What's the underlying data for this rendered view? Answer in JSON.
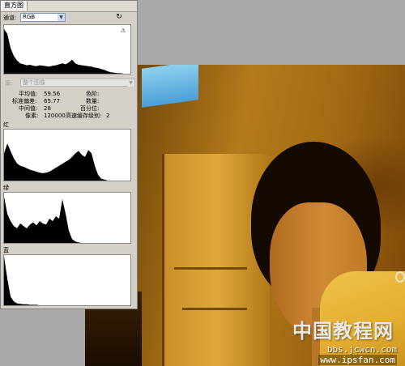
{
  "panel": {
    "tab_title": "直方图",
    "channel_label": "通道:",
    "channel_value": "RGB",
    "source_label": "源:",
    "source_value": "整个图像",
    "warning_glyph": "⚠"
  },
  "stats": {
    "mean_label": "平均值:",
    "mean_value": "59.56",
    "stddev_label": "标准偏差:",
    "stddev_value": "65.77",
    "median_label": "中间值:",
    "median_value": "28",
    "pixels_label": "像素:",
    "pixels_value": "120000",
    "level_label": "色阶:",
    "level_value": "",
    "count_label": "数量:",
    "count_value": "",
    "percentile_label": "百分位:",
    "percentile_value": "",
    "cache_label": "高速缓存级别:",
    "cache_value": "2"
  },
  "channels": {
    "red_label": "红",
    "green_label": "绿",
    "blue_label": "蓝"
  },
  "histograms": {
    "rgb": [
      0.95,
      0.85,
      0.55,
      0.38,
      0.28,
      0.22,
      0.2,
      0.18,
      0.19,
      0.17,
      0.16,
      0.18,
      0.17,
      0.16,
      0.15,
      0.17,
      0.18,
      0.2,
      0.22,
      0.2,
      0.24,
      0.3,
      0.22,
      0.19,
      0.18,
      0.17,
      0.16,
      0.15,
      0.13,
      0.12,
      0.1,
      0.08,
      0.05,
      0.03,
      0.02,
      0.01,
      0.01,
      0.0,
      0.0,
      0.0
    ],
    "red": [
      0.55,
      0.75,
      0.6,
      0.45,
      0.35,
      0.3,
      0.28,
      0.25,
      0.22,
      0.2,
      0.18,
      0.16,
      0.15,
      0.16,
      0.18,
      0.22,
      0.26,
      0.3,
      0.34,
      0.38,
      0.42,
      0.48,
      0.55,
      0.6,
      0.52,
      0.48,
      0.62,
      0.55,
      0.3,
      0.12,
      0.04,
      0.02,
      0.0,
      0.0,
      0.0,
      0.0,
      0.0,
      0.0,
      0.0,
      0.0
    ],
    "green": [
      0.95,
      0.6,
      0.45,
      0.35,
      0.3,
      0.4,
      0.35,
      0.3,
      0.38,
      0.42,
      0.36,
      0.45,
      0.4,
      0.38,
      0.5,
      0.45,
      0.55,
      0.5,
      0.9,
      0.6,
      0.25,
      0.08,
      0.03,
      0.01,
      0.0,
      0.0,
      0.0,
      0.0,
      0.0,
      0.0,
      0.0,
      0.0,
      0.0,
      0.0,
      0.0,
      0.0,
      0.0,
      0.0,
      0.0,
      0.0
    ],
    "blue": [
      1.0,
      0.55,
      0.18,
      0.08,
      0.04,
      0.03,
      0.02,
      0.02,
      0.01,
      0.01,
      0.01,
      0.0,
      0.0,
      0.0,
      0.0,
      0.0,
      0.0,
      0.0,
      0.0,
      0.0,
      0.0,
      0.0,
      0.0,
      0.0,
      0.0,
      0.0,
      0.0,
      0.0,
      0.0,
      0.0,
      0.0,
      0.0,
      0.0,
      0.0,
      0.0,
      0.0,
      0.0,
      0.0,
      0.0,
      0.0
    ]
  },
  "watermark": {
    "site_name": "中国教程网",
    "url1": "bbs.jcwcn.com",
    "url2": "www.ipsfan.com"
  }
}
